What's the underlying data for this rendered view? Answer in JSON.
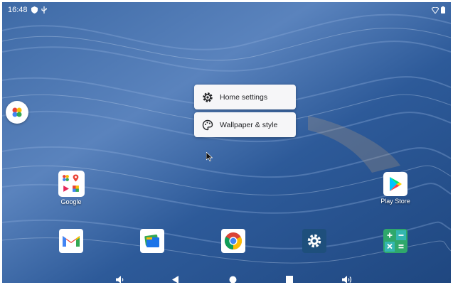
{
  "status_bar": {
    "time": "16:48",
    "icons": [
      "shield-icon",
      "usb-icon",
      "wifi-icon",
      "battery-icon"
    ]
  },
  "context_menu": {
    "items": [
      {
        "label": "Home settings",
        "icon": "gear-icon"
      },
      {
        "label": "Wallpaper & style",
        "icon": "palette-icon"
      }
    ]
  },
  "desktop": {
    "folder": {
      "label": "Google"
    },
    "apps": [
      {
        "label": "Play Store",
        "icon": "play-store-icon"
      }
    ]
  },
  "dock": {
    "apps": [
      "gmail-icon",
      "files-icon",
      "chrome-icon",
      "settings-icon",
      "calculator-icon"
    ]
  },
  "nav_bar": {
    "buttons": [
      "volume-down-icon",
      "back-icon",
      "home-icon",
      "recents-icon",
      "volume-up-icon"
    ]
  },
  "colors": {
    "wallpaper_base": "#2f5c98",
    "menu_background": "#f6f6f8",
    "settings_tile": "#1e4f7c",
    "calculator_tile": "#2fa86b"
  }
}
